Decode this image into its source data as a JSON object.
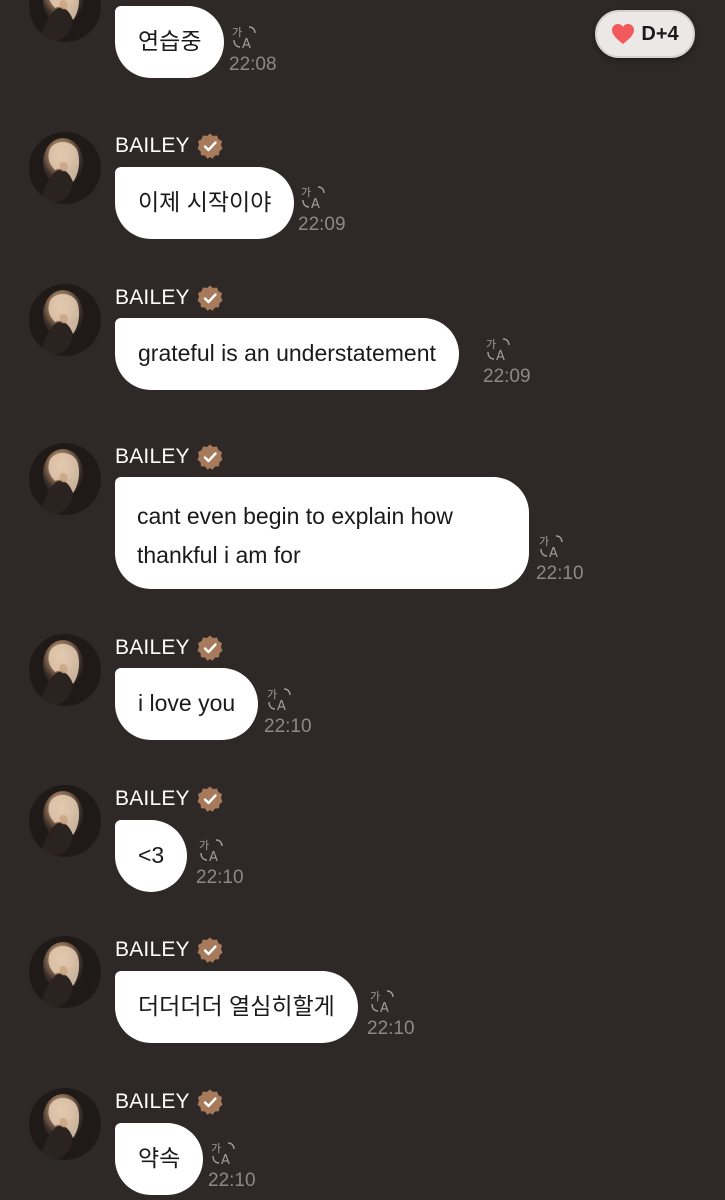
{
  "badge": {
    "label": "D+4",
    "heart_color": "#f25b5b"
  },
  "colors": {
    "background": "#2e2926",
    "bubble": "#ffffff",
    "verified": "#a67a5b",
    "time": "#8f8884"
  },
  "messages": [
    {
      "sender": "",
      "text": "연습중",
      "time": "22:08"
    },
    {
      "sender": "BAILEY",
      "text": "이제 시작이야",
      "time": "22:09"
    },
    {
      "sender": "BAILEY",
      "text": "grateful is an understatement",
      "time": "22:09"
    },
    {
      "sender": "BAILEY",
      "text": "cant even begin to explain how thankful i am for",
      "time": "22:10"
    },
    {
      "sender": "BAILEY",
      "text": "i love you",
      "time": "22:10"
    },
    {
      "sender": "BAILEY",
      "text": "<3",
      "time": "22:10"
    },
    {
      "sender": "BAILEY",
      "text": "더더더더 열심히할게",
      "time": "22:10"
    },
    {
      "sender": "BAILEY",
      "text": "약속",
      "time": "22:10"
    }
  ],
  "icons": {
    "avatar": "artist-avatar",
    "verified": "verified-badge-icon",
    "translate": "translate-icon",
    "heart": "heart-icon"
  }
}
